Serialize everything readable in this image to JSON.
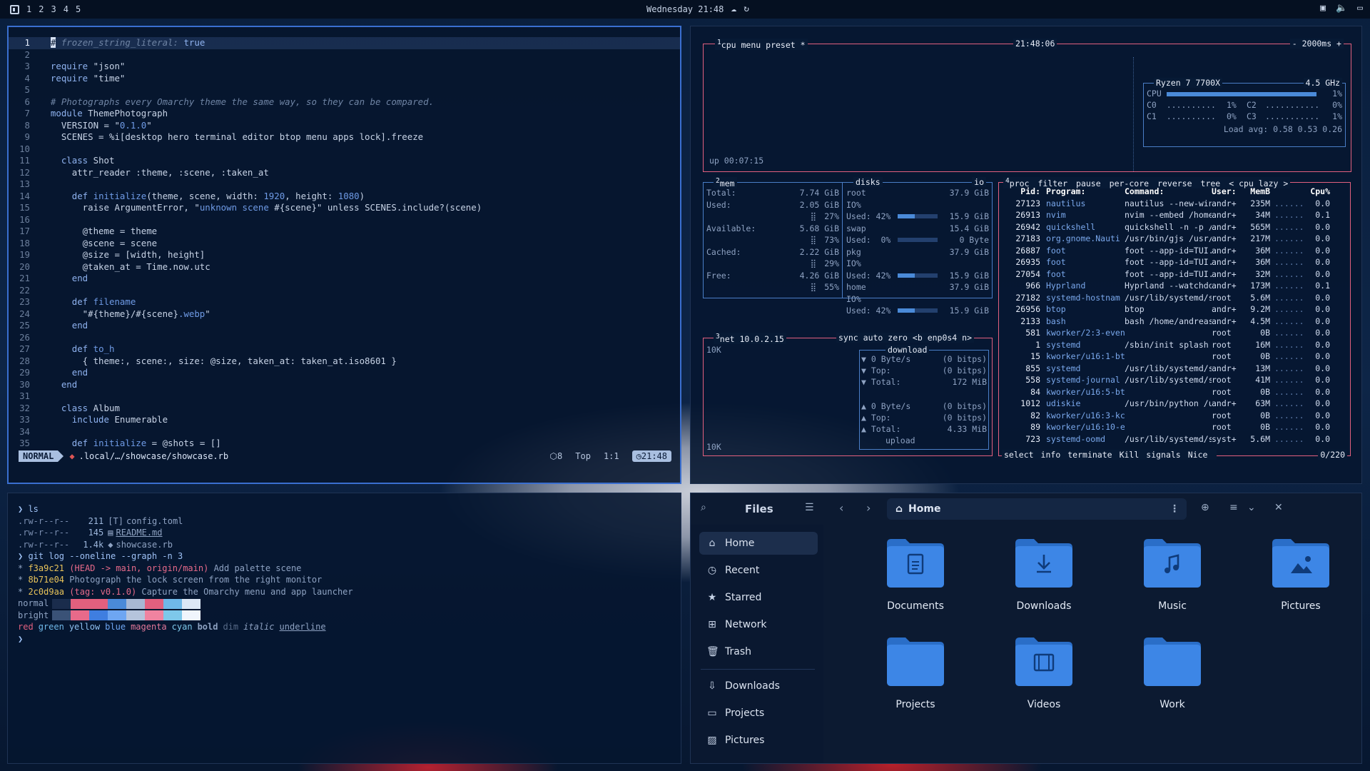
{
  "topbar": {
    "workspaces": [
      "1",
      "2",
      "3",
      "4",
      "5"
    ],
    "clock": "Wednesday 21:48"
  },
  "editor": {
    "lines": [
      {
        "n": "1",
        "segs": [
          [
            "cur",
            "#"
          ],
          [
            "cm",
            " frozen_string_literal: "
          ],
          [
            "kw",
            "true"
          ]
        ]
      },
      {
        "n": "2",
        "segs": []
      },
      {
        "n": "3",
        "segs": [
          [
            "kw",
            "require "
          ],
          [
            "st",
            "\"json\""
          ]
        ]
      },
      {
        "n": "4",
        "segs": [
          [
            "kw",
            "require "
          ],
          [
            "st",
            "\"time\""
          ]
        ]
      },
      {
        "n": "5",
        "segs": []
      },
      {
        "n": "6",
        "segs": [
          [
            "cm",
            "# Photographs every Omarchy theme the same way, so they can be compared."
          ]
        ]
      },
      {
        "n": "7",
        "segs": [
          [
            "kw",
            "module "
          ],
          [
            "code",
            "ThemePhotograph"
          ]
        ]
      },
      {
        "n": "8",
        "segs": [
          [
            "code",
            "  VERSION = "
          ],
          [
            "st",
            "\""
          ],
          [
            "sp",
            "0.1.0"
          ],
          [
            "st",
            "\""
          ]
        ]
      },
      {
        "n": "9",
        "segs": [
          [
            "code",
            "  SCENES = %i[desktop hero terminal editor btop menu apps lock].freeze"
          ]
        ]
      },
      {
        "n": "10",
        "segs": []
      },
      {
        "n": "11",
        "segs": [
          [
            "kw",
            "  class "
          ],
          [
            "code",
            "Shot"
          ]
        ]
      },
      {
        "n": "12",
        "segs": [
          [
            "code",
            "    attr_reader :theme, :scene, :taken_at"
          ]
        ]
      },
      {
        "n": "13",
        "segs": []
      },
      {
        "n": "14",
        "segs": [
          [
            "kw",
            "    def "
          ],
          [
            "sp",
            "initialize"
          ],
          [
            "code",
            "(theme, scene, width: "
          ],
          [
            "sp",
            "1920"
          ],
          [
            "code",
            ", height: "
          ],
          [
            "sp",
            "1080"
          ],
          [
            "code",
            ")"
          ]
        ]
      },
      {
        "n": "15",
        "segs": [
          [
            "code",
            "      raise ArgumentError, "
          ],
          [
            "st",
            "\""
          ],
          [
            "sp",
            "unknown scene "
          ],
          [
            "st",
            "#{scene}\""
          ],
          [
            "code",
            " unless SCENES.include?(scene)"
          ]
        ]
      },
      {
        "n": "16",
        "segs": []
      },
      {
        "n": "17",
        "segs": [
          [
            "code",
            "      @theme = theme"
          ]
        ]
      },
      {
        "n": "18",
        "segs": [
          [
            "code",
            "      @scene = scene"
          ]
        ]
      },
      {
        "n": "19",
        "segs": [
          [
            "code",
            "      @size = [width, height]"
          ]
        ]
      },
      {
        "n": "20",
        "segs": [
          [
            "code",
            "      @taken_at = Time.now.utc"
          ]
        ]
      },
      {
        "n": "21",
        "segs": [
          [
            "kw",
            "    end"
          ]
        ]
      },
      {
        "n": "22",
        "segs": []
      },
      {
        "n": "23",
        "segs": [
          [
            "kw",
            "    def "
          ],
          [
            "sp",
            "filename"
          ]
        ]
      },
      {
        "n": "24",
        "segs": [
          [
            "code",
            "      \"#{theme}/#{scene}"
          ],
          [
            "sp",
            ".webp"
          ],
          [
            "code",
            "\""
          ]
        ]
      },
      {
        "n": "25",
        "segs": [
          [
            "kw",
            "    end"
          ]
        ]
      },
      {
        "n": "26",
        "segs": []
      },
      {
        "n": "27",
        "segs": [
          [
            "kw",
            "    def "
          ],
          [
            "sp",
            "to_h"
          ]
        ]
      },
      {
        "n": "28",
        "segs": [
          [
            "code",
            "      { theme:, scene:, size: @size, taken_at: taken_at.iso8601 }"
          ]
        ]
      },
      {
        "n": "29",
        "segs": [
          [
            "kw",
            "    end"
          ]
        ]
      },
      {
        "n": "30",
        "segs": [
          [
            "kw",
            "  end"
          ]
        ]
      },
      {
        "n": "31",
        "segs": []
      },
      {
        "n": "32",
        "segs": [
          [
            "kw",
            "  class "
          ],
          [
            "code",
            "Album"
          ]
        ]
      },
      {
        "n": "33",
        "segs": [
          [
            "kw",
            "    include "
          ],
          [
            "code",
            "Enumerable"
          ]
        ]
      },
      {
        "n": "34",
        "segs": []
      },
      {
        "n": "35",
        "segs": [
          [
            "kw",
            "    def "
          ],
          [
            "sp",
            "initialize"
          ],
          [
            "code",
            " = @shots = []"
          ]
        ]
      }
    ],
    "status": {
      "mode": "NORMAL",
      "file": ".local/…/showcase/showcase.rb",
      "count": "8",
      "position": "Top",
      "cursor": "1:1",
      "time": "21:48"
    }
  },
  "btop": {
    "cpu_box": {
      "tabs": [
        "cpu",
        "menu",
        "preset *"
      ],
      "clock": "21:48:06",
      "refresh": "- 2000ms +",
      "uptime": "up 00:07:15"
    },
    "cpu_detail": {
      "title": "Ryzen 7 7700X",
      "freq": "4.5 GHz",
      "cpu_label": "CPU",
      "cpu_pct": "1%",
      "cores": [
        {
          "n": "C0",
          "v": "1%"
        },
        {
          "n": "C2",
          "v": "0%"
        },
        {
          "n": "C1",
          "v": "0%"
        },
        {
          "n": "C3",
          "v": "1%"
        }
      ],
      "load": "Load avg: 0.58 0.53 0.26"
    },
    "mem": {
      "title": "mem",
      "rows": [
        {
          "k": "Total:",
          "v": "7.74 GiB"
        },
        {
          "k": "Used:",
          "v": "2.05 GiB",
          "pct": "27%"
        },
        {
          "k": "Available:",
          "v": "5.68 GiB",
          "pct": "73%"
        },
        {
          "k": "Cached:",
          "v": "2.22 GiB",
          "pct": "29%"
        },
        {
          "k": "Free:",
          "v": "4.26 GiB",
          "pct": "55%"
        }
      ]
    },
    "disks": {
      "title": "disks",
      "io": "io",
      "rows": [
        {
          "name": "root",
          "size": "37.9 GiB",
          "used": "Used: 42%",
          "usedsz": "15.9 GiB",
          "used_fraction": 0.42
        },
        {
          "name": "swap",
          "size": "15.4 GiB",
          "used": "Used:  0%",
          "usedsz": "0 Byte",
          "used_fraction": 0.0
        },
        {
          "name": "pkg",
          "size": "37.9 GiB",
          "used": "Used: 42%",
          "usedsz": "15.9 GiB",
          "used_fraction": 0.42
        },
        {
          "name": "home",
          "size": "37.9 GiB",
          "used": "Used: 42%",
          "usedsz": "15.9 GiB",
          "used_fraction": 0.42
        }
      ],
      "io_label": "IO%"
    },
    "net": {
      "title": "net",
      "ip": "10.0.2.15",
      "opts": [
        "sync",
        "auto",
        "zero"
      ],
      "iface": "<b enp0s4 n>",
      "scale_top": "10K",
      "scale_bottom": "10K",
      "download": {
        "label": "download",
        "rate": "0 Byte/s",
        "rate_bits": "(0 bitps)",
        "top": "Top:",
        "top_bits": "(0 bitps)",
        "total": "Total:",
        "total_v": "172 MiB"
      },
      "upload": {
        "label": "upload",
        "rate": "0 Byte/s",
        "rate_bits": "(0 bitps)",
        "top": "Top:",
        "top_bits": "(0 bitps)",
        "total": "Total:",
        "total_v": "4.33 MiB"
      }
    },
    "proc": {
      "title": "proc",
      "tabs": [
        "filter",
        "pause",
        "per-core",
        "reverse",
        "tree",
        "< cpu lazy >"
      ],
      "headers": [
        "Pid:",
        "Program:",
        "Command:",
        "User:",
        "MemB",
        "",
        "Cpu%"
      ],
      "rows": [
        [
          "27123",
          "nautilus",
          "nautilus --new-win",
          "andr+",
          "235M",
          "0.0"
        ],
        [
          "26913",
          "nvim",
          "nvim --embed /home",
          "andr+",
          "34M",
          "0.1"
        ],
        [
          "26942",
          "quickshell",
          "quickshell -n -p /",
          "andr+",
          "565M",
          "0.0"
        ],
        [
          "27183",
          "org.gnome.Nauti",
          "/usr/bin/gjs /usr/",
          "andr+",
          "217M",
          "0.0"
        ],
        [
          "26887",
          "foot",
          "foot --app-id=TUI.",
          "andr+",
          "36M",
          "0.0"
        ],
        [
          "26935",
          "foot",
          "foot --app-id=TUI.",
          "andr+",
          "36M",
          "0.0"
        ],
        [
          "27054",
          "foot",
          "foot --app-id=TUI.",
          "andr+",
          "32M",
          "0.0"
        ],
        [
          "966",
          "Hyprland",
          "Hyprland --watchdo",
          "andr+",
          "173M",
          "0.1"
        ],
        [
          "27182",
          "systemd-hostnam",
          "/usr/lib/systemd/s",
          "root",
          "5.6M",
          "0.0"
        ],
        [
          "26956",
          "btop",
          "btop",
          "andr+",
          "9.2M",
          "0.0"
        ],
        [
          "2133",
          "bash",
          "bash /home/andreas",
          "andr+",
          "4.5M",
          "0.0"
        ],
        [
          "581",
          "kworker/2:3-even",
          "",
          "root",
          "0B",
          "0.0"
        ],
        [
          "1",
          "systemd",
          "/sbin/init splash",
          "root",
          "16M",
          "0.0"
        ],
        [
          "15",
          "kworker/u16:1-bt",
          "",
          "root",
          "0B",
          "0.0"
        ],
        [
          "855",
          "systemd",
          "/usr/lib/systemd/s",
          "andr+",
          "13M",
          "0.0"
        ],
        [
          "558",
          "systemd-journal",
          "/usr/lib/systemd/s",
          "root",
          "41M",
          "0.0"
        ],
        [
          "84",
          "kworker/u16:5-bt",
          "",
          "root",
          "0B",
          "0.0"
        ],
        [
          "1012",
          "udiskie",
          "/usr/bin/python /u",
          "andr+",
          "63M",
          "0.0"
        ],
        [
          "82",
          "kworker/u16:3-kc",
          "",
          "root",
          "0B",
          "0.0"
        ],
        [
          "89",
          "kworker/u16:10-e",
          "",
          "root",
          "0B",
          "0.0"
        ],
        [
          "723",
          "systemd-oomd",
          "/usr/lib/systemd/s",
          "syst+",
          "5.6M",
          "0.0"
        ]
      ],
      "footer": [
        "select",
        "info",
        "terminate",
        "Kill",
        "signals",
        "Nice"
      ],
      "count": "0/220"
    }
  },
  "terminal": {
    "lines": [
      {
        "cls": "prompt",
        "t": "❯ ls"
      },
      {
        "cls": "ls",
        "perm": ".rw-r--r--",
        "size": "211",
        "name": "config.toml",
        "icon": "[T]"
      },
      {
        "cls": "ls",
        "perm": ".rw-r--r--",
        "size": "145",
        "name": "README.md",
        "icon": "▤",
        "underline": true
      },
      {
        "cls": "ls",
        "perm": ".rw-r--r--",
        "size": "1.4k",
        "name": "showcase.rb",
        "icon": "◆"
      },
      {
        "cls": "prompt",
        "t": "❯ git log --oneline --graph -n 3"
      },
      {
        "cls": "git",
        "hash": "f3a9c21",
        "ref": "(HEAD -> main, origin/main)",
        "msg": " Add palette scene"
      },
      {
        "cls": "git",
        "hash": "8b71e04",
        "ref": "",
        "msg": "Photograph the lock screen from the right monitor"
      },
      {
        "cls": "git",
        "hash": "2c0d9aa",
        "ref": "(tag: v0.1.0)",
        "msg": " Capture the Omarchy menu and app launcher"
      }
    ],
    "palette_normal": "normal",
    "palette_bright": "bright",
    "normal_colors": [
      "#1a2c4c",
      "#e2607e",
      "#e2607e",
      "#4a8ad8",
      "#a7b8d3",
      "#e2607e",
      "#6fb8e8",
      "#dce7f6"
    ],
    "bright_colors": [
      "#3a5277",
      "#e86a8a",
      "#3f7ee0",
      "#6ea6f2",
      "#b5c4dc",
      "#f083a0",
      "#7ec8ea",
      "#f0f5fc"
    ],
    "color_words": [
      "red",
      "green",
      "yellow",
      "blue",
      "magenta",
      "cyan",
      "bold",
      "dim",
      "italic",
      "underline"
    ],
    "prompt_end": "❯"
  },
  "files": {
    "title": "Files",
    "path": "Home",
    "sidebar": [
      {
        "label": "Home",
        "icon": "home-icon",
        "active": true
      },
      {
        "label": "Recent",
        "icon": "clock-icon"
      },
      {
        "label": "Starred",
        "icon": "star-icon"
      },
      {
        "label": "Network",
        "icon": "network-icon"
      },
      {
        "label": "Trash",
        "icon": "trash-icon"
      },
      {
        "label": "Downloads",
        "icon": "download-icon"
      },
      {
        "label": "Projects",
        "icon": "folder-icon"
      },
      {
        "label": "Pictures",
        "icon": "picture-icon"
      }
    ],
    "folders": [
      {
        "label": "Documents",
        "glyph": "doc"
      },
      {
        "label": "Downloads",
        "glyph": "down"
      },
      {
        "label": "Music",
        "glyph": "music"
      },
      {
        "label": "Pictures",
        "glyph": "pic"
      },
      {
        "label": "Projects",
        "glyph": "none"
      },
      {
        "label": "Videos",
        "glyph": "film"
      },
      {
        "label": "Work",
        "glyph": "none"
      }
    ],
    "accent": "#3d86e6"
  }
}
